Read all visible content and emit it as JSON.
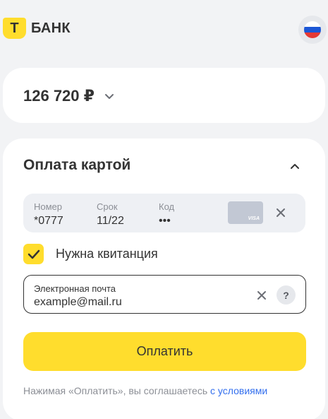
{
  "header": {
    "logo_letter": "Т",
    "logo_text": "БАНК",
    "language": "ru"
  },
  "amount": {
    "value": "126 720 ₽"
  },
  "payment": {
    "title": "Оплата картой",
    "card": {
      "number_label": "Номер",
      "number_value": "*0777",
      "expiry_label": "Срок",
      "expiry_value": "11/22",
      "cvc_label": "Код",
      "cvc_value": "•••",
      "brand": "VISA"
    },
    "receipt": {
      "label": "Нужна квитанция",
      "checked": true
    },
    "email": {
      "label": "Электронная почта",
      "value": "example@mail.ru",
      "help": "?"
    },
    "pay_button": "Оплатить",
    "terms_text": "Нажимая «Оплатить», вы соглашаетесь ",
    "terms_link": "с условиями"
  },
  "colors": {
    "accent": "#ffdd2d",
    "link": "#336fee",
    "background": "#f2f3f5"
  }
}
